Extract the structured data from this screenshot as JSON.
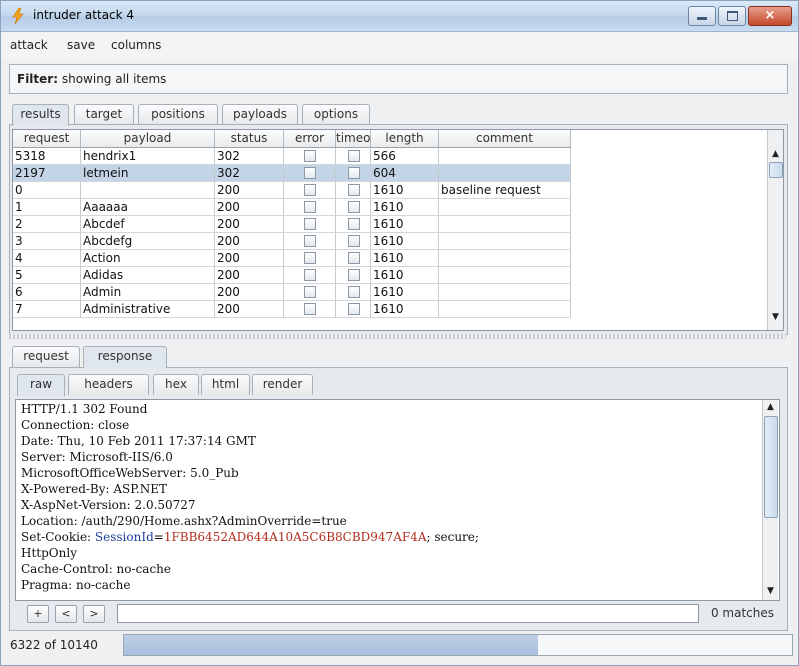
{
  "window": {
    "title": "intruder attack 4"
  },
  "menu": [
    "attack",
    "save",
    "columns"
  ],
  "filter": {
    "label": "Filter:",
    "text": "showing all items"
  },
  "main_tabs": [
    "results",
    "target",
    "positions",
    "payloads",
    "options"
  ],
  "results_table": {
    "columns": [
      "request",
      "payload",
      "status",
      "error",
      "timeo...",
      "length",
      "comment"
    ],
    "rows": [
      {
        "request": "5318",
        "payload": "hendrix1",
        "status": "302",
        "length": "566",
        "comment": ""
      },
      {
        "request": "2197",
        "payload": "letmein",
        "status": "302",
        "length": "604",
        "comment": "",
        "selected": true
      },
      {
        "request": "0",
        "payload": "",
        "status": "200",
        "length": "1610",
        "comment": "baseline request"
      },
      {
        "request": "1",
        "payload": "Aaaaaa",
        "status": "200",
        "length": "1610",
        "comment": ""
      },
      {
        "request": "2",
        "payload": "Abcdef",
        "status": "200",
        "length": "1610",
        "comment": ""
      },
      {
        "request": "3",
        "payload": "Abcdefg",
        "status": "200",
        "length": "1610",
        "comment": ""
      },
      {
        "request": "4",
        "payload": "Action",
        "status": "200",
        "length": "1610",
        "comment": ""
      },
      {
        "request": "5",
        "payload": "Adidas",
        "status": "200",
        "length": "1610",
        "comment": ""
      },
      {
        "request": "6",
        "payload": "Admin",
        "status": "200",
        "length": "1610",
        "comment": ""
      },
      {
        "request": "7",
        "payload": "Administrative",
        "status": "200",
        "length": "1610",
        "comment": ""
      }
    ]
  },
  "msg_tabs": [
    "request",
    "response"
  ],
  "view_tabs": [
    "raw",
    "headers",
    "hex",
    "html",
    "render"
  ],
  "response_lines": [
    "HTTP/1.1 302 Found",
    "Connection: close",
    "Date: Thu, 10 Feb 2011 17:37:14 GMT",
    "Server: Microsoft-IIS/6.0",
    "MicrosoftOfficeWebServer: 5.0_Pub",
    "X-Powered-By: ASP.NET",
    "X-AspNet-Version: 2.0.50727",
    "Location: /auth/290/Home.ashx?AdminOverride=true",
    "Set-Cookie: SessionId=1FBB6452AD644A10A5C6B8CBD947AF4A; secure;",
    "HttpOnly",
    "Cache-Control: no-cache",
    "Pragma: no-cache"
  ],
  "cookie": {
    "prefix": "Set-Cookie: ",
    "name": "SessionId",
    "eq": "=",
    "value": "1FBB6452AD644A10A5C6B8CBD947AF4A",
    "suffix": "; secure;"
  },
  "search": {
    "buttons": [
      "+",
      "<",
      ">"
    ],
    "value": "",
    "matches": "0 matches"
  },
  "status": {
    "text": "6322 of 10140",
    "progress": 0.62
  }
}
